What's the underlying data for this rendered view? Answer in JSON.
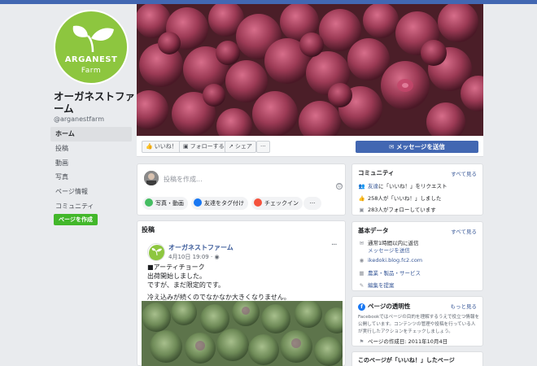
{
  "page": {
    "name": "オーガネストファーム",
    "handle": "@arganestfarm",
    "logo_line1": "ARGANEST",
    "logo_line2": "Farm",
    "create_page_label": "ページを作成"
  },
  "nav": {
    "home": "ホーム",
    "posts": "投稿",
    "videos": "動画",
    "photos": "写真",
    "page_info": "ページ情報",
    "community": "コミュニティ"
  },
  "actions": {
    "like": "いいね！",
    "follow": "フォローする",
    "share": "シェア",
    "more": "···",
    "send_message": "メッセージを送信"
  },
  "composer": {
    "placeholder": "投稿を作成...",
    "photo_video": "写真・動画",
    "tag_friends": "友達をタグ付け",
    "check_in": "チェックイン",
    "more": "···"
  },
  "posts": {
    "section_title": "投稿",
    "author": "オーガネストファーム",
    "date": "4月10日 19:09 · ",
    "more": "···",
    "line1": "■アーティチョーク",
    "line2": "出荷開始しました。",
    "line3": "ですが、まだ限定的です。",
    "line4": "冷え込みが続くのでなかなか大きくなりません。"
  },
  "community": {
    "title": "コミュニティ",
    "see_all": "すべて見る",
    "invite_link": "友達",
    "invite_text": "に「いいね！」をリクエスト",
    "likes": "258人が「いいね！」しました",
    "follows": "283人がフォローしています"
  },
  "about": {
    "title": "基本データ",
    "see_all": "すべて見る",
    "response": "通常1時間以内に返信",
    "send_message": "メッセージを送信",
    "website": "ikedoki.blog.fc2.com",
    "category": "農業・製品・サービス",
    "suggest_edits": "編集を提案"
  },
  "transparency": {
    "title": "ページの透明性",
    "see_more": "もっと見る",
    "description": "Facebookではページの目的を理解するうえで役立つ情報を公開しています。コンテンツの管理や投稿を行っている人が実行したアクションをチェックしましょう。",
    "created": "ページの作成日: 2011年10月4日"
  },
  "liked_pages": {
    "title": "このページが「いいね！」したページ"
  },
  "colors": {
    "brand_blue": "#4267b2",
    "link_blue": "#385898",
    "logo_green": "#8dc63f",
    "create_green": "#42b72a"
  }
}
